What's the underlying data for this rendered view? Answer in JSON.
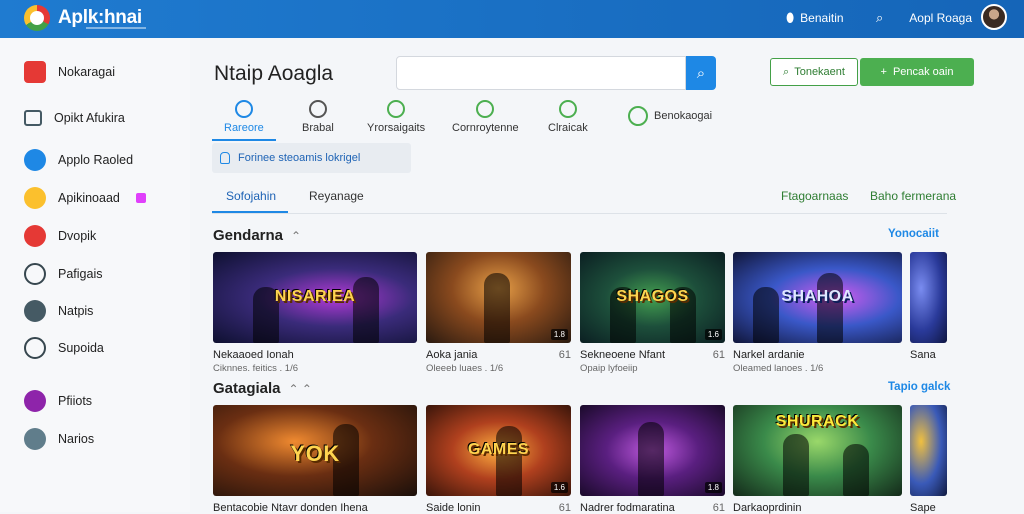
{
  "colors": {
    "topbar": "#1e74c8",
    "accent_blue": "#1e88e5",
    "accent_green": "#4caf50"
  },
  "topbar": {
    "brand": "Aplk:hnai",
    "pin_label": "Benaitin",
    "pin_icon": "location-pin-icon",
    "user_label": "Aopl Roaga",
    "search_icon": "search-icon"
  },
  "sidebar": {
    "items": [
      {
        "label": "Nokaragai",
        "icon": "cube-icon",
        "color": "#e53935"
      },
      {
        "label": "Opikt Afukira",
        "icon": "window-icon",
        "color": "#455a64"
      },
      {
        "label": "Applo Raoled",
        "icon": "gamepad-icon",
        "color": "#1e88e5"
      },
      {
        "label": "Apikinoaad",
        "icon": "android-icon",
        "color": "#fbc02d"
      },
      {
        "label": "Dvopik",
        "icon": "sparkle-icon",
        "color": "#e53935"
      },
      {
        "label": "Pafigais",
        "icon": "spin-icon",
        "color": "#37474f"
      },
      {
        "label": "Natpis",
        "icon": "plane-icon",
        "color": "#37474f"
      },
      {
        "label": "Supoida",
        "icon": "settings-icon",
        "color": "#37474f"
      },
      {
        "label": "Pfiiots",
        "icon": "mushroom-icon",
        "color": "#8e24aa"
      },
      {
        "label": "Narios",
        "icon": "user-icon",
        "color": "#37474f"
      }
    ]
  },
  "header": {
    "title": "Ntaip Aoagla",
    "search_placeholder": "",
    "outline_button": "Tonekaent",
    "green_button": "Pencak oain"
  },
  "categories": [
    {
      "label": "Rareore"
    },
    {
      "label": "Brabal"
    },
    {
      "label": "Yrorsaigaits"
    },
    {
      "label": "Cornroytenne"
    },
    {
      "label": "Clraicak"
    },
    {
      "label": "Benokaogai"
    }
  ],
  "notice": "Forinee steoamis lokrigel",
  "tabs": {
    "active": "Sofojahin",
    "second": "Reyanage",
    "link1": "Ftagoarnaas",
    "link2": "Baho fermerana"
  },
  "sections": [
    {
      "title": "Gendarna",
      "link": "Yonocaiit",
      "cards": [
        {
          "art": "NISARIEA",
          "name": "Nekaaoed Ionah",
          "rank": "",
          "meta": "Ciknnes. feitics . 1/6"
        },
        {
          "art": "",
          "name": "Aoka jania",
          "rank": "61",
          "meta": "Oleeeb luaes . 1/6",
          "size": "1.8"
        },
        {
          "art": "SHAGOS",
          "name": "Sekneoene Nfant",
          "rank": "61",
          "meta": "Opaip lyfoeiip",
          "size": "1.6"
        },
        {
          "art": "SHAHOA",
          "name": "Narkel ardanie",
          "rank": "",
          "meta": "Oleamed lanoes . 1/6"
        },
        {
          "art": "",
          "name": "Sana",
          "rank": "",
          "meta": ""
        }
      ]
    },
    {
      "title": "Gatagiala",
      "link": "Tapio galck",
      "cards": [
        {
          "art": "YOK",
          "name": "Bentacobie Ntavr donden Ihena",
          "rank": "",
          "meta": ""
        },
        {
          "art": "GAMES",
          "name": "Saide lonin",
          "rank": "61",
          "meta": "",
          "size": "1.6"
        },
        {
          "art": "",
          "name": "Nadrer fodmaratina",
          "rank": "61",
          "meta": "",
          "size": "1.8"
        },
        {
          "art": "SHURACK",
          "name": "Darkaoprdinin",
          "rank": "",
          "meta": ""
        },
        {
          "art": "",
          "name": "Sape",
          "rank": "",
          "meta": ""
        }
      ]
    }
  ]
}
